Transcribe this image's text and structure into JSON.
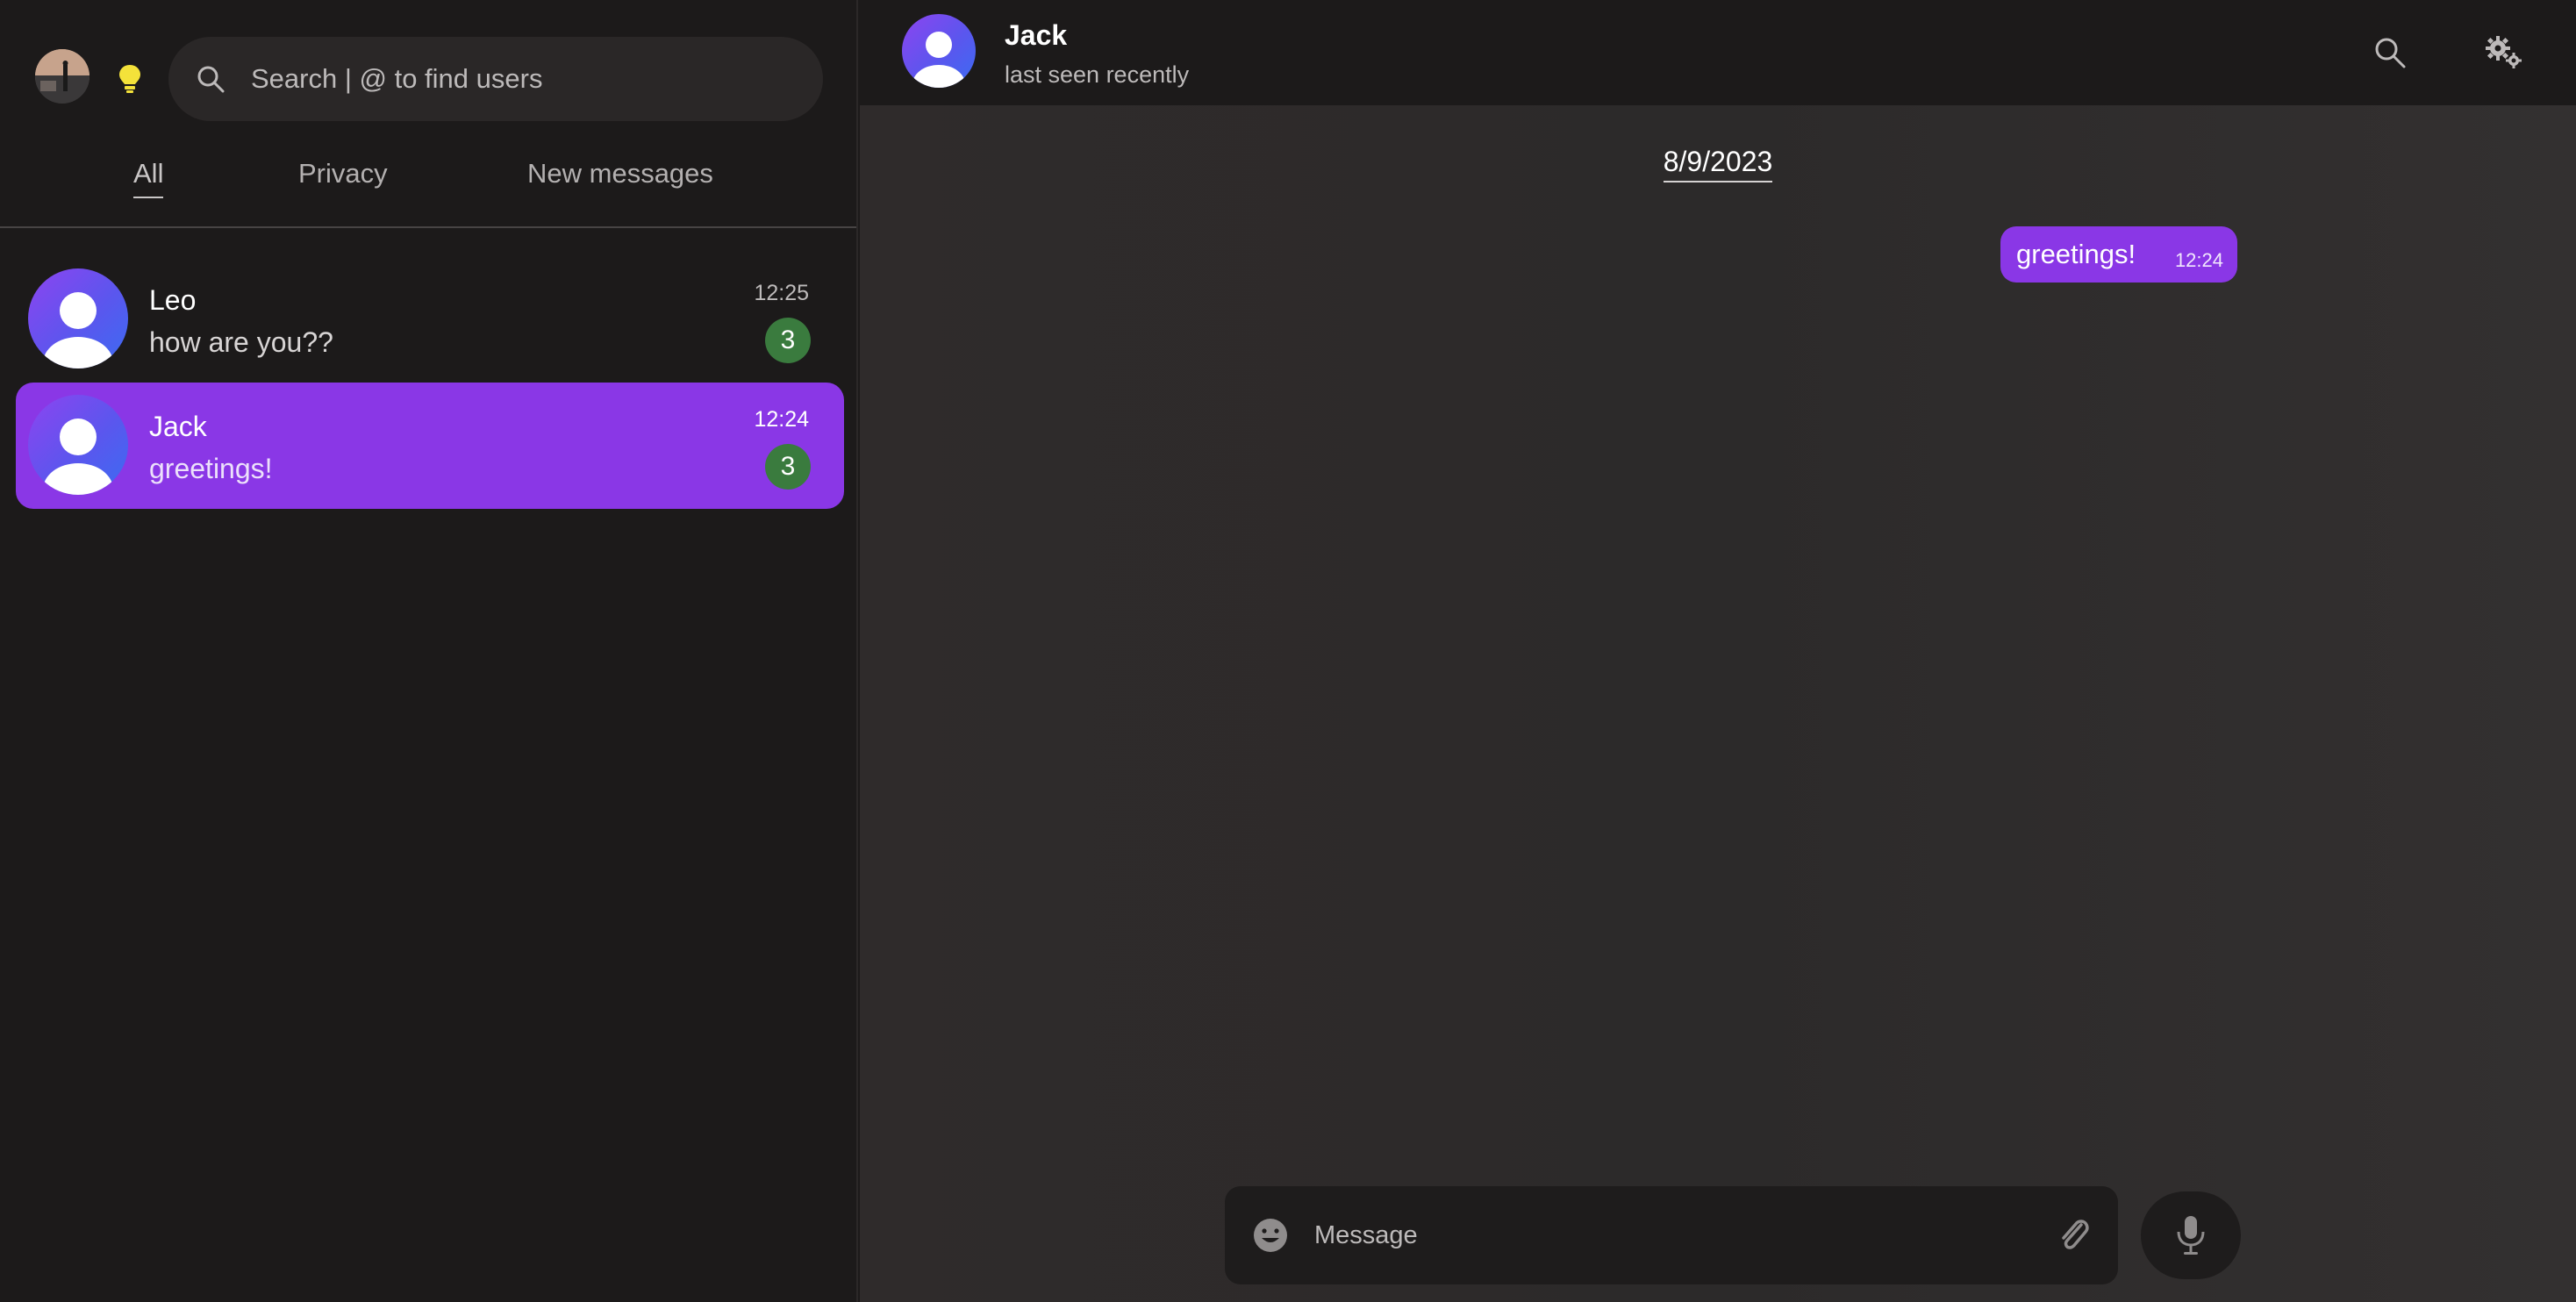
{
  "sidebar": {
    "search": {
      "placeholder": "Search | @ to find users"
    },
    "tabs": [
      {
        "label": "All",
        "active": true
      },
      {
        "label": "Privacy",
        "active": false
      },
      {
        "label": "New messages",
        "active": false
      }
    ],
    "chats": [
      {
        "name": "Leo",
        "preview": "how are you??",
        "time": "12:25",
        "unread": "3",
        "selected": false
      },
      {
        "name": "Jack",
        "preview": "greetings!",
        "time": "12:24",
        "unread": "3",
        "selected": true
      }
    ]
  },
  "header": {
    "name": "Jack",
    "status": "last seen recently"
  },
  "conversation": {
    "date": "8/9/2023",
    "messages": [
      {
        "text": "greetings!",
        "time": "12:24",
        "outgoing": true
      }
    ]
  },
  "composer": {
    "placeholder": "Message"
  },
  "colors": {
    "accent": "#8a37e6",
    "badge": "#3a7b3e",
    "sidebar_bg": "#1c1a1a",
    "chat_bg": "#2f2b2b",
    "avatar_gradient_start": "#8d44f0",
    "avatar_gradient_end": "#3b6cf2"
  }
}
